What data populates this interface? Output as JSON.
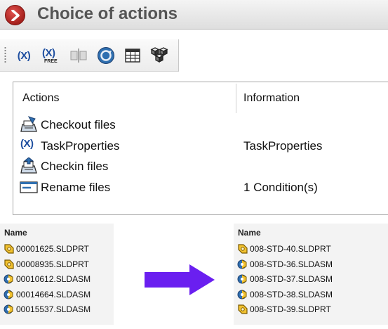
{
  "header": {
    "title": "Choice of actions",
    "badge_icon": "chevron-right-icon",
    "badge_color": "#c0302b"
  },
  "toolbar": {
    "buttons": [
      {
        "name": "variable-button",
        "text": "(X)",
        "icon": "variable-icon"
      },
      {
        "name": "free-variable-button",
        "text": "(X)",
        "subtext": "FREE",
        "icon": "free-variable-icon"
      },
      {
        "name": "split-button",
        "icon": "split-icon"
      },
      {
        "name": "refresh-button",
        "icon": "refresh-globe-icon"
      },
      {
        "name": "table-button",
        "icon": "table-icon"
      },
      {
        "name": "assembly-button",
        "icon": "assembly-cubes-icon"
      }
    ]
  },
  "actions": {
    "columns": {
      "actions": "Actions",
      "information": "Information"
    },
    "rows": [
      {
        "label": "Checkout files",
        "info": "",
        "icon": "checkout-icon"
      },
      {
        "label": "TaskProperties",
        "info": "TaskProperties",
        "icon": "variable-icon"
      },
      {
        "label": "Checkin files",
        "info": "",
        "icon": "checkin-icon"
      },
      {
        "label": "Rename files",
        "info": "1 Condition(s)",
        "icon": "rename-icon"
      }
    ]
  },
  "before_list": {
    "header": "Name",
    "files": [
      {
        "name": "00001625.SLDPRT",
        "type": "part"
      },
      {
        "name": "00008935.SLDPRT",
        "type": "part"
      },
      {
        "name": "00010612.SLDASM",
        "type": "assembly"
      },
      {
        "name": "00014664.SLDASM",
        "type": "assembly"
      },
      {
        "name": "00015537.SLDASM",
        "type": "assembly"
      }
    ]
  },
  "after_list": {
    "header": "Name",
    "files": [
      {
        "name": "008-STD-40.SLDPRT",
        "type": "part"
      },
      {
        "name": "008-STD-36.SLDASM",
        "type": "assembly"
      },
      {
        "name": "008-STD-37.SLDASM",
        "type": "assembly"
      },
      {
        "name": "008-STD-38.SLDASM",
        "type": "assembly"
      },
      {
        "name": "008-STD-39.SLDPRT",
        "type": "part"
      }
    ]
  },
  "arrow": {
    "icon": "arrow-right-icon",
    "color": "#6a1ff0"
  }
}
